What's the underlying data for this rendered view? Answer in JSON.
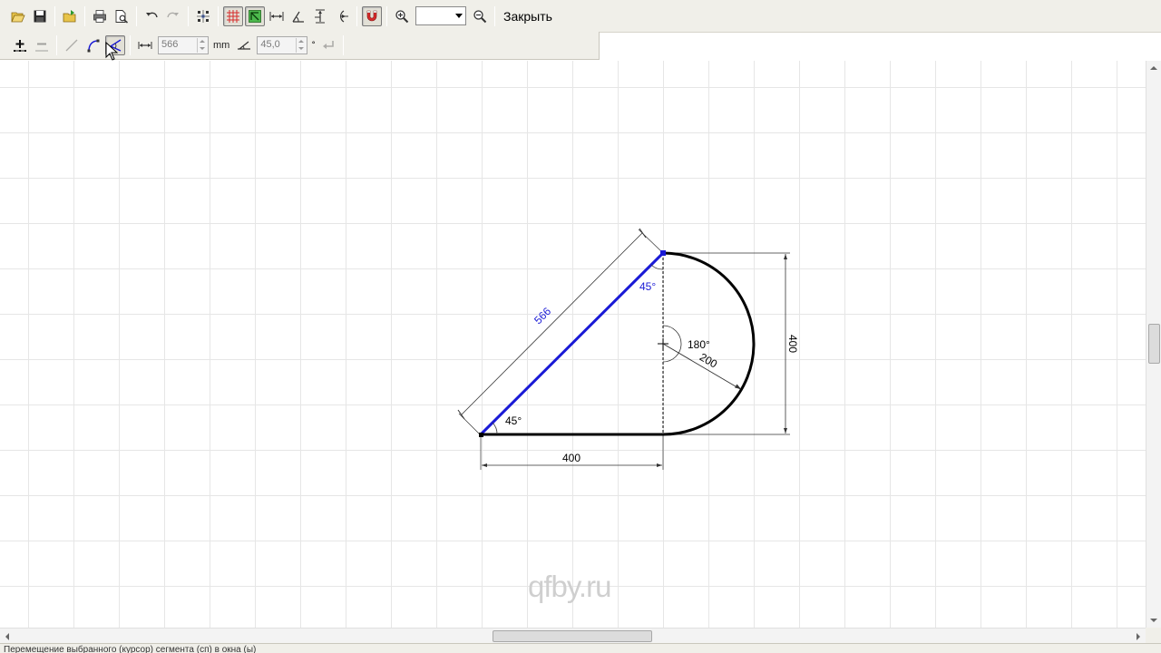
{
  "toolbar": {
    "buttons": [
      "open-icon",
      "save-icon",
      "open-folder-icon",
      "print-icon",
      "print-preview-icon",
      "undo-icon",
      "redo-icon",
      "snap-points-icon",
      "grid-icon",
      "snap-grid-icon",
      "horizontal-dimension-icon",
      "angle-dimension-icon",
      "vertical-dimension-icon",
      "arc-dimension-icon",
      "magnet-icon",
      "zoom-in-icon",
      "zoom-out-icon"
    ],
    "zoom_value": "",
    "close_label": "Закрыть"
  },
  "edit_toolbar": {
    "length_value": "566",
    "length_unit": "mm",
    "angle_value": "45,0",
    "angle_unit": "°"
  },
  "drawing": {
    "line_length_label": "566",
    "top_angle_label": "45°",
    "bottom_angle_label": "45°",
    "arc_angle_label": "180°",
    "radius_label": "200",
    "base_width_label": "400",
    "height_label": "400",
    "colors": {
      "selected_segment": "#1a1ad6",
      "outline": "#000000",
      "dimension": "#333333"
    }
  },
  "watermark": "qfby.ru",
  "statusbar": {
    "text": "Перемещение выбранного (курсор) сегмента (сп) в окна (ы)"
  }
}
